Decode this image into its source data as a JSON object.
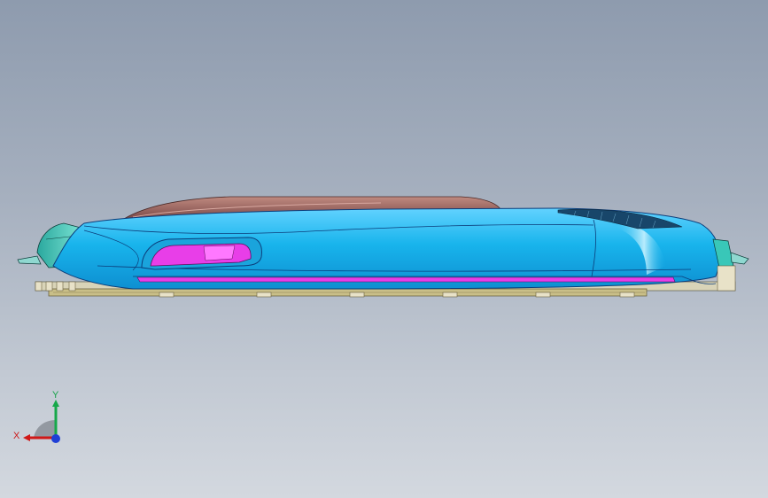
{
  "window": {
    "view_background": [
      "#8e9bae",
      "#d3d8df"
    ]
  },
  "model": {
    "colors": {
      "body": "#18b4ec",
      "body_highlight": "#62d2ff",
      "inner_pocket": "#e83ee8",
      "top_strip": "#a0706a",
      "left_clip": "#39c7b8",
      "base_plate": "#c9bf88",
      "edge_lines": "#0c3d7a"
    }
  },
  "triad": {
    "x_label": "X",
    "y_label": "Y",
    "x_color": "#d01818",
    "y_color": "#16a84a",
    "z_color": "#1f3fd6"
  }
}
